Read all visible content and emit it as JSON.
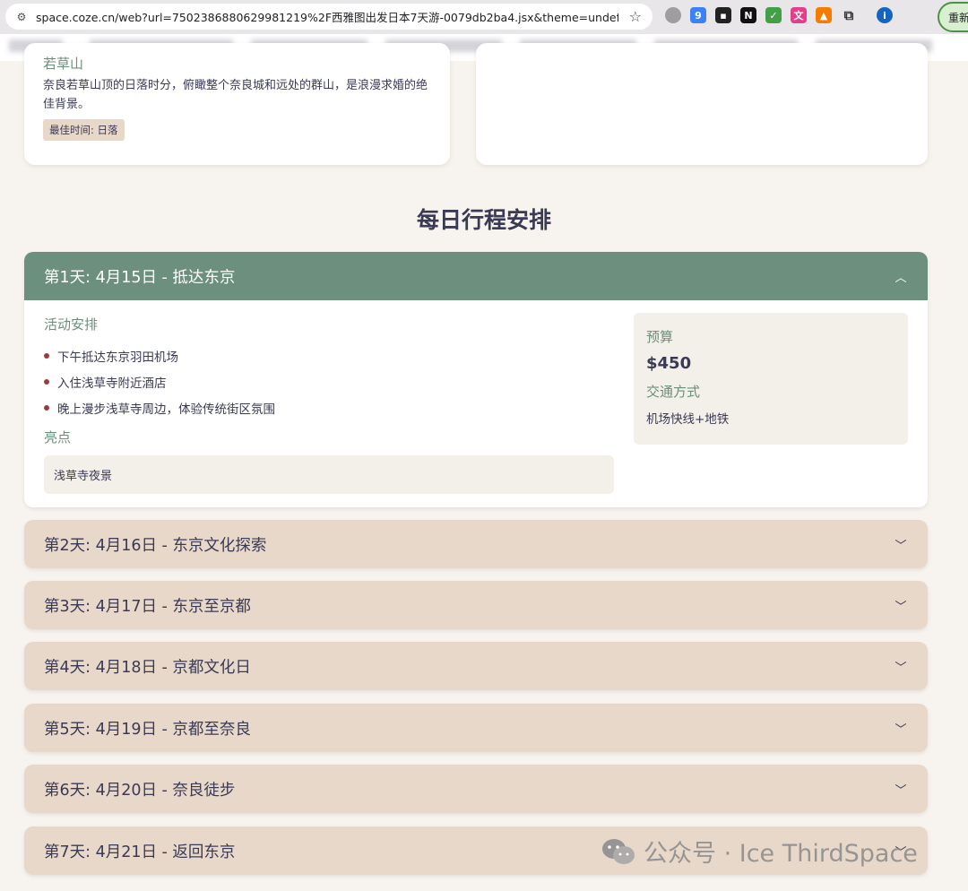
{
  "browser": {
    "url": "space.coze.cn/web?url=7502386880629981219%2F西雅图出发日本7天游-0079db2ba4.jsx&theme=undefin...",
    "reload_label": "重新"
  },
  "spot": {
    "name": "若草山",
    "description": "奈良若草山顶的日落时分，俯瞰整个奈良城和远处的群山，是浪漫求婚的绝佳背景。",
    "badge": "最佳时间: 日落"
  },
  "itinerary": {
    "title": "每日行程安排",
    "day1": {
      "header": "第1天: 4月15日 - 抵达东京",
      "activities_title": "活动安排",
      "activities": [
        "下午抵达东京羽田机场",
        "入住浅草寺附近酒店",
        "晚上漫步浅草寺周边，体验传统街区氛围"
      ],
      "highlights_title": "亮点",
      "highlight": "浅草寺夜景",
      "budget_label": "预算",
      "budget": "$450",
      "transport_label": "交通方式",
      "transport": "机场快线+地铁"
    },
    "days": [
      "第2天: 4月16日 - 东京文化探索",
      "第3天: 4月17日 - 东京至京都",
      "第4天: 4月18日 - 京都文化日",
      "第5天: 4月19日 - 京都至奈良",
      "第6天: 4月20日 - 奈良徒步",
      "第7天: 4月21日 - 返回东京"
    ]
  },
  "watermark": "公众号 · Ice ThirdSpace",
  "colors": {
    "accent_green": "#6d8f7d",
    "tan": "#e8d8ca",
    "bullet_red": "#9c3b3b",
    "background": "#f7f3ee"
  }
}
